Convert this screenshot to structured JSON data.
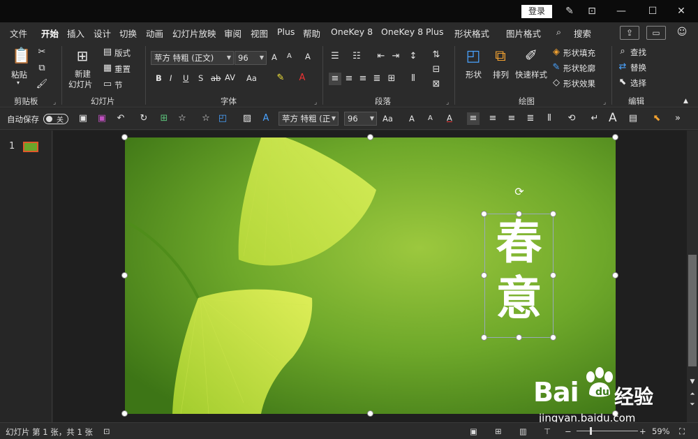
{
  "titlebar": {
    "login": "登录"
  },
  "tabs": {
    "items": [
      "文件",
      "开始",
      "插入",
      "设计",
      "切换",
      "动画",
      "幻灯片放映",
      "审阅",
      "视图",
      "Plus",
      "帮助",
      "OneKey 8",
      "OneKey 8 Plus",
      "形状格式",
      "图片格式"
    ],
    "active": "开始",
    "search": "搜索"
  },
  "ribbon": {
    "clipboard": {
      "paste": "粘贴",
      "label": "剪贴板"
    },
    "slides": {
      "new_slide_1": "新建",
      "new_slide_2": "幻灯片",
      "layout": "版式",
      "reset": "重置",
      "section": "节",
      "label": "幻灯片"
    },
    "font": {
      "family": "苹方 特粗 (正文)",
      "size": "96",
      "bold": "B",
      "italic": "I",
      "underline": "U",
      "shadow": "S",
      "strike": "ab",
      "spacing": "AV",
      "case": "Aa",
      "grow": "A",
      "shrink": "A",
      "clear": "A",
      "label": "字体"
    },
    "paragraph": {
      "label": "段落"
    },
    "drawing": {
      "shape": "形状",
      "arrange": "排列",
      "quick_styles": "快速样式",
      "fill": "形状填充",
      "outline": "形状轮廓",
      "effects": "形状效果",
      "label": "绘图"
    },
    "editing": {
      "find": "查找",
      "replace": "替换",
      "select": "选择",
      "label": "编辑"
    }
  },
  "qat": {
    "autosave": "自动保存",
    "toggle": "关",
    "font_family": "苹方 特粗 (正",
    "font_size": "96",
    "case": "Aa",
    "grow": "A",
    "shrink": "A",
    "color": "A",
    "bigA": "A"
  },
  "slides_pane": {
    "number": "1"
  },
  "slide": {
    "title_line1": "春",
    "title_line2": "意"
  },
  "statusbar": {
    "slide_info": "幻灯片 第 1 张，共 1 张",
    "zoom": "59%"
  },
  "watermark": {
    "brand": "Bai",
    "brand2": "经验",
    "url": "jingyan.baidu.com"
  }
}
